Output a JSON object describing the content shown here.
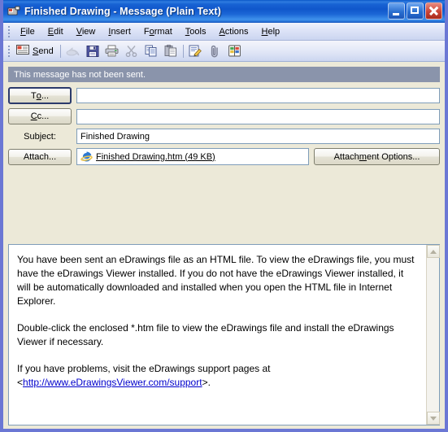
{
  "window": {
    "title": "Finished Drawing - Message (Plain Text)",
    "title_icon": "message-envelope-icon",
    "minimize_label": "Minimize",
    "maximize_label": "Maximize",
    "close_label": "Close"
  },
  "menu": {
    "items": [
      {
        "label": "File",
        "accel": "F"
      },
      {
        "label": "Edit",
        "accel": "E"
      },
      {
        "label": "View",
        "accel": "V"
      },
      {
        "label": "Insert",
        "accel": "I"
      },
      {
        "label": "Format",
        "accel": "o"
      },
      {
        "label": "Tools",
        "accel": "T"
      },
      {
        "label": "Actions",
        "accel": "A"
      },
      {
        "label": "Help",
        "accel": "H"
      }
    ]
  },
  "toolbar": {
    "send_label": "Send",
    "send_accel": "S",
    "buttons": [
      {
        "name": "send-button",
        "icon": "envelope-icon",
        "label": "Send",
        "enabled": true
      },
      {
        "name": "accounts-button",
        "icon": "reply-arrow-icon",
        "label": "",
        "enabled": false
      },
      {
        "name": "save-button",
        "icon": "floppy-disk-icon",
        "label": "",
        "enabled": true
      },
      {
        "name": "print-button",
        "icon": "printer-icon",
        "label": "",
        "enabled": true
      },
      {
        "name": "cut-button",
        "icon": "scissors-icon",
        "label": "",
        "enabled": false
      },
      {
        "name": "copy-button",
        "icon": "copy-pages-icon",
        "label": "",
        "enabled": true
      },
      {
        "name": "paste-button",
        "icon": "clipboard-icon",
        "label": "",
        "enabled": true
      },
      {
        "name": "signature-button",
        "icon": "pencil-note-icon",
        "label": "",
        "enabled": true
      },
      {
        "name": "attach-file-button",
        "icon": "paperclip-icon",
        "label": "",
        "enabled": true
      },
      {
        "name": "address-book-button",
        "icon": "address-book-icon",
        "label": "",
        "enabled": true
      }
    ]
  },
  "message": {
    "info_bar": "This message has not been sent.",
    "to_button": "To...",
    "to_accel": "o",
    "to_value": "",
    "cc_button": "Cc...",
    "cc_accel": "C",
    "cc_value": "",
    "subject_label": "Subject:",
    "subject_accel": "j",
    "subject_value": "Finished Drawing",
    "attach_button": "Attach...",
    "attachment_name": "Finished Drawing.htm (49 KB)",
    "attachment_icon": "internet-explorer-icon",
    "attachment_options_button": "Attachment Options...",
    "attachment_options_accel": "m"
  },
  "body": {
    "paragraph_1": "You have been sent an eDrawings file as an HTML file. To view the eDrawings file, you must have the eDrawings Viewer installed. If you do not have the eDrawings Viewer installed, it will be automatically downloaded and installed when you open the HTML file in Internet Explorer.",
    "paragraph_2": "Double-click the enclosed *.htm file to view the eDrawings file and install the eDrawings Viewer if necessary.",
    "paragraph_3_prefix": "If you have problems, visit the eDrawings support pages at",
    "paragraph_3_bracket_open": "<",
    "link_text": "http://www.eDrawingsViewer.com/support",
    "paragraph_3_bracket_close": ">."
  },
  "colors": {
    "title_blue": "#1863d4",
    "window_frame": "#6b77d4",
    "client_bg": "#ece9d8",
    "info_bar_bg": "#8a94ab",
    "link": "#0000cc",
    "close_red": "#c94436"
  }
}
